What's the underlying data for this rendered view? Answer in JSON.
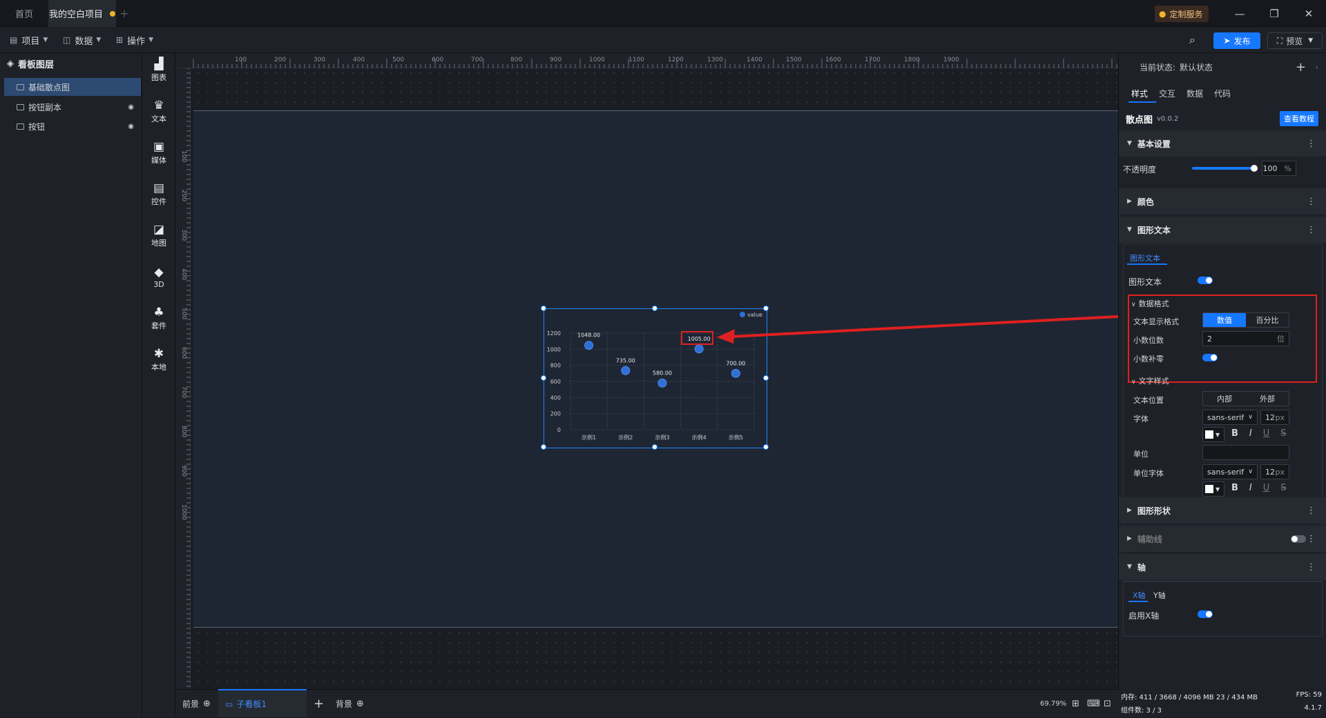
{
  "tabs": [
    {
      "label": "首页"
    },
    {
      "label": "我的空白项目",
      "modified": true
    }
  ],
  "titlebar": {
    "custom_service": "定制服务"
  },
  "toolbar": {
    "menus": [
      "项目",
      "数据",
      "操作"
    ],
    "publish": "发布",
    "preview": "预览"
  },
  "layers": {
    "title": "看板图层",
    "items": [
      "基础散点图",
      "按钮副本",
      "按钮"
    ]
  },
  "components": [
    "图表",
    "文本",
    "媒体",
    "控件",
    "地图",
    "3D",
    "套件",
    "本地"
  ],
  "ruler": {
    "top": [
      "100",
      "200",
      "300",
      "400",
      "500",
      "600",
      "700",
      "800",
      "900",
      "1000",
      "1100",
      "1200",
      "1300",
      "1400",
      "1500",
      "1600",
      "1700",
      "1800",
      "1900"
    ],
    "left": [
      "100",
      "200",
      "300",
      "400",
      "500",
      "600",
      "700",
      "800",
      "900",
      "1000"
    ]
  },
  "chart_data": {
    "type": "scatter",
    "legend": "value",
    "legend_position": "top-right",
    "categories": [
      "示例1",
      "示例2",
      "示例3",
      "示例4",
      "示例5"
    ],
    "values": [
      1048,
      735,
      580,
      1005,
      700
    ],
    "labels": [
      "1048.00",
      "735.00",
      "580.00",
      "1005.00",
      "700.00"
    ],
    "ylim": [
      0,
      1200
    ],
    "yticks": [
      "0",
      "200",
      "400",
      "600",
      "800",
      "1000",
      "1200"
    ],
    "point_color": "#2f6fd8"
  },
  "bottom": {
    "front": "前景",
    "subboard": "子看板1",
    "background": "背景",
    "zoom": "69.79%"
  },
  "panel": {
    "state_label": "当前状态:",
    "state_value": "默认状态",
    "tabs": [
      "样式",
      "交互",
      "数据",
      "代码"
    ],
    "component_name": "散点图",
    "version": "v0.0.2",
    "tutorial": "查看教程",
    "basic": "基本设置",
    "opacity_label": "不透明度",
    "opacity_value": "100",
    "opacity_unit": "%",
    "color": "颜色",
    "shape_text": "图形文本",
    "sub_tab": "图形文本",
    "shape_text_toggle": "图形文本",
    "data_format": "数据格式",
    "display_format_label": "文本显示格式",
    "display_format_options": [
      "数值",
      "百分比"
    ],
    "decimals_label": "小数位数",
    "decimals_value": "2",
    "decimals_unit": "位",
    "pad_zero_label": "小数补零",
    "text_style": "文字样式",
    "text_pos_label": "文本位置",
    "text_pos_options": [
      "内部",
      "外部"
    ],
    "font_label": "字体",
    "font_value": "sans-serif",
    "font_size": "12",
    "font_unit": "px",
    "unit_label": "单位",
    "unit_font_label": "单位字体",
    "unit_font_value": "sans-serif",
    "unit_font_size": "12",
    "shape": "图形形状",
    "guide": "辅助线",
    "axis": "轴",
    "axis_tabs": [
      "X轴",
      "Y轴"
    ],
    "enable_x": "启用X轴"
  },
  "status": {
    "memory": "内存: 411 / 3668 / 4096 MB  23 / 434 MB",
    "fps": "FPS: 59",
    "count": "组件数: 3 / 3",
    "version": "4.1.7"
  }
}
